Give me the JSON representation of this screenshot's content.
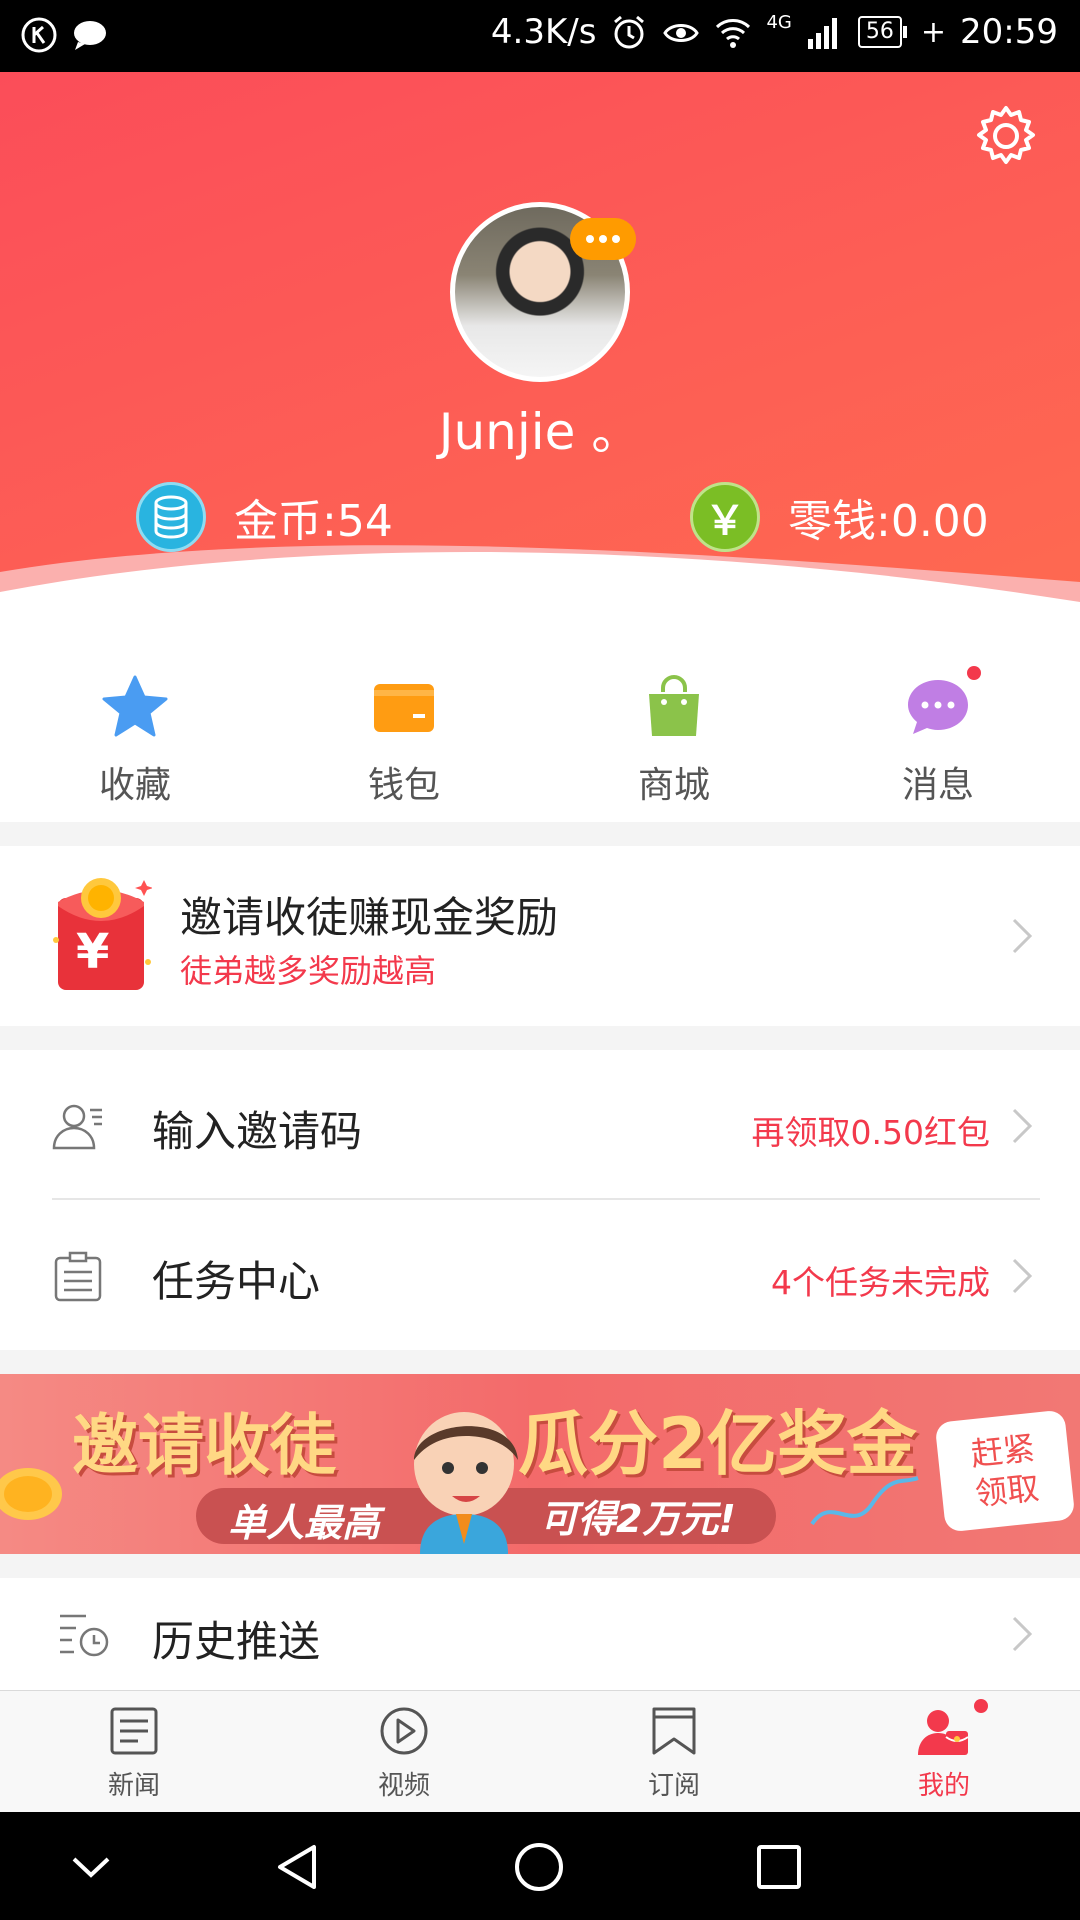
{
  "status_bar": {
    "net_speed": "4.3K/s",
    "signal_tag": "4G",
    "battery": "56",
    "time": "20:59"
  },
  "header": {
    "username": "Junjie 。",
    "coins_label": "金币:54",
    "change_label": "零钱:0.00",
    "yen_glyph": "￥"
  },
  "quick_actions": [
    {
      "label": "收藏",
      "icon": "star-icon"
    },
    {
      "label": "钱包",
      "icon": "wallet-icon"
    },
    {
      "label": "商城",
      "icon": "shopping-bag-icon"
    },
    {
      "label": "消息",
      "icon": "message-bubble-icon",
      "unread": true
    }
  ],
  "invite": {
    "title": "邀请收徒赚现金奖励",
    "subtitle": "徒弟越多奖励越高",
    "envelope_glyph": "¥"
  },
  "list": {
    "invite_code": {
      "label": "输入邀请码",
      "hint": "再领取0.50红包"
    },
    "task_center": {
      "label": "任务中心",
      "hint": "4个任务未完成"
    }
  },
  "banner": {
    "headline_left": "邀请收徒",
    "headline_right": "瓜分2亿奖金",
    "sub_left": "单人最高",
    "sub_right": "可得2万元!",
    "cta": "赶紧领取"
  },
  "history": {
    "label": "历史推送"
  },
  "tabs": [
    {
      "label": "新闻",
      "icon": "news-icon",
      "active": false
    },
    {
      "label": "视频",
      "icon": "play-circle-icon",
      "active": false
    },
    {
      "label": "订阅",
      "icon": "bookmark-icon",
      "active": false
    },
    {
      "label": "我的",
      "icon": "profile-icon",
      "active": true
    }
  ],
  "colors": {
    "accent": "#f3394c",
    "header_start": "#fb4d59",
    "header_end": "#fe6a50",
    "coin_blue": "#29b4e0",
    "yuan_green": "#7bbe25"
  }
}
